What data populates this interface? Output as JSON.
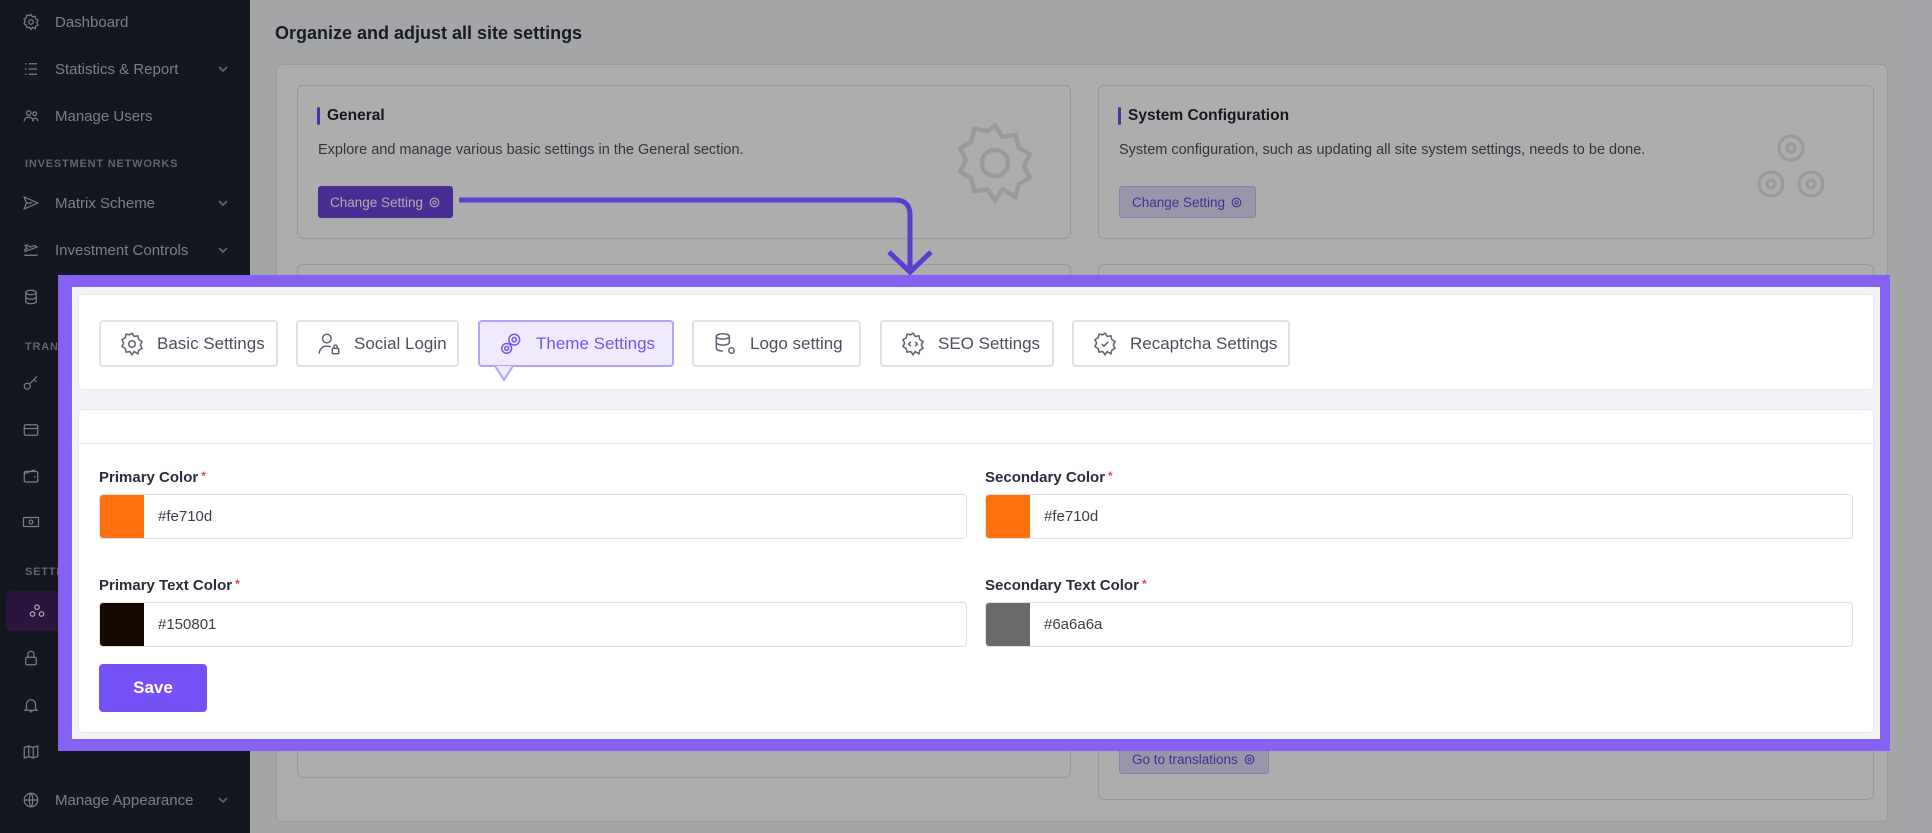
{
  "sidebar": {
    "items": [
      {
        "label": "Dashboard",
        "icon": "gear-icon"
      },
      {
        "label": "Statistics & Report",
        "icon": "list-icon"
      },
      {
        "label": "Manage Users",
        "icon": "users-icon"
      },
      {
        "label": "Matrix Scheme",
        "icon": "send-icon"
      },
      {
        "label": "Investment Controls",
        "icon": "plane-icon"
      },
      {
        "label": "Manage Appearance",
        "icon": "globe-icon"
      }
    ],
    "sections": [
      "INVESTMENT NETWORKS",
      "TRANS",
      "SETTI"
    ]
  },
  "page": {
    "title": "Organize and adjust all site settings"
  },
  "cards": {
    "general": {
      "title": "General",
      "desc": "Explore and manage various basic settings in the General section.",
      "button": "Change Setting"
    },
    "system": {
      "title": "System Configuration",
      "desc": "System configuration, such as updating all site system settings, needs to be done.",
      "button": "Change Setting"
    },
    "translations": {
      "button": "Go to translations"
    }
  },
  "tabs": [
    {
      "label": "Basic Settings",
      "icon": "gear-icon"
    },
    {
      "label": "Social Login",
      "icon": "user-lock-icon"
    },
    {
      "label": "Theme Settings",
      "icon": "gears-icon",
      "active": true
    },
    {
      "label": "Logo setting",
      "icon": "database-gear-icon"
    },
    {
      "label": "SEO Settings",
      "icon": "gear-code-icon"
    },
    {
      "label": "Recaptcha Settings",
      "icon": "gear-check-icon"
    }
  ],
  "form": {
    "primary_color": {
      "label": "Primary Color",
      "value": "#fe710d",
      "swatch": "#fe710d"
    },
    "secondary_color": {
      "label": "Secondary Color",
      "value": "#fe710d",
      "swatch": "#fe710d"
    },
    "primary_text_color": {
      "label": "Primary Text Color",
      "value": "#150801",
      "swatch": "#150801"
    },
    "secondary_text_color": {
      "label": "Secondary Text Color",
      "value": "#6a6a6a",
      "swatch": "#6a6a6a"
    },
    "required_mark": "*",
    "save_label": "Save"
  },
  "colors": {
    "accent": "#7552f5",
    "highlight_frame": "#8760f4"
  }
}
